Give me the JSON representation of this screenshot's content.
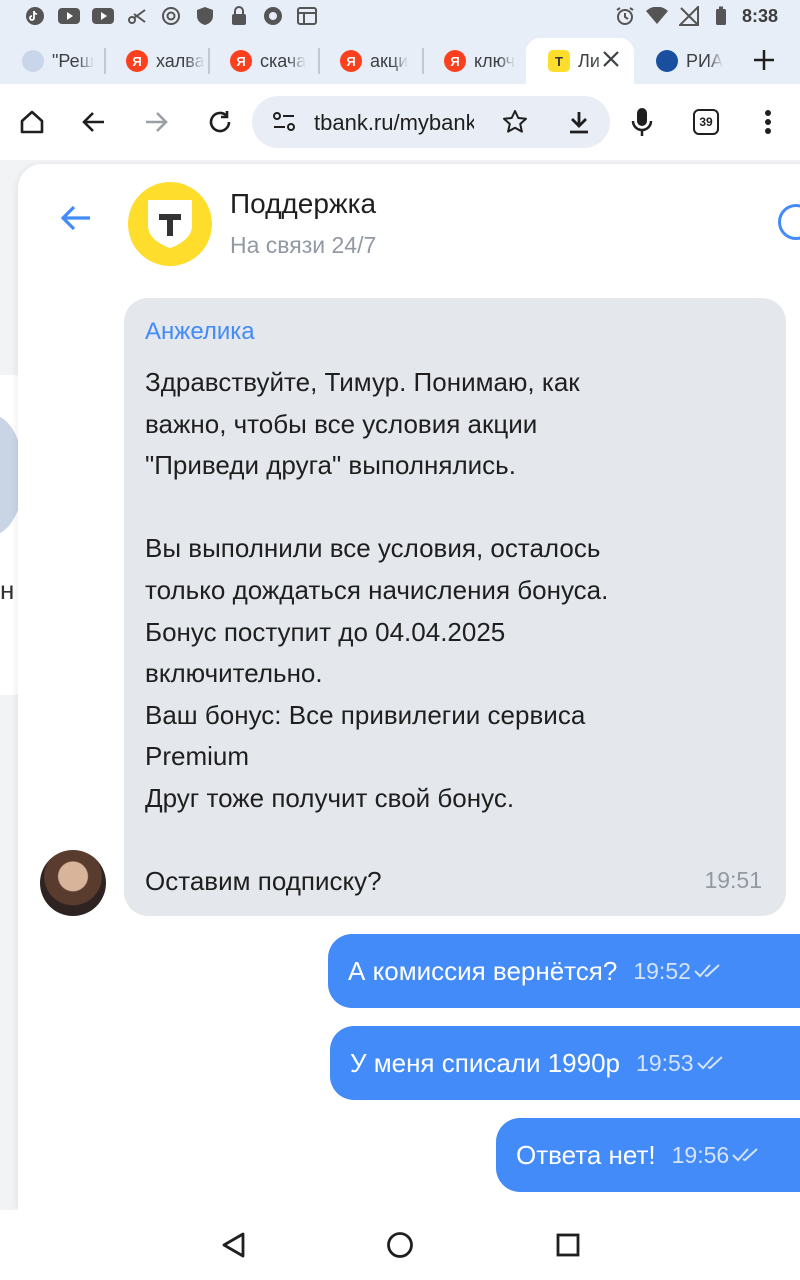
{
  "status_bar": {
    "time": "8:38",
    "left_icons": [
      "tiktok-icon",
      "youtube-icon",
      "youtube-icon",
      "scissors-icon",
      "at-icon",
      "shield-icon",
      "lock-icon",
      "chrome-icon",
      "calendar-icon"
    ],
    "right_icons": [
      "alarm-icon",
      "wifi-icon",
      "no-signal-icon",
      "battery-icon"
    ]
  },
  "tabs": [
    {
      "label": "\"Реш",
      "favicon": "resh-icon"
    },
    {
      "label": "халва",
      "favicon": "yandex-icon"
    },
    {
      "label": "скача",
      "favicon": "yandex-icon"
    },
    {
      "label": "акци",
      "favicon": "yandex-icon"
    },
    {
      "label": "ключ",
      "favicon": "yandex-icon"
    },
    {
      "label": "Ли",
      "favicon": "tbank-icon",
      "active": true
    },
    {
      "label": "РИА",
      "favicon": "ria-icon"
    }
  ],
  "toolbar": {
    "url": "tbank.ru/mybank",
    "tab_count": "39"
  },
  "chat": {
    "title": "Поддержка",
    "subtitle": "На связи 24/7",
    "incoming": {
      "sender": "Анжелика",
      "lines": [
        "Здравствуйте, Тимур. Понимаю, как",
        "важно, чтобы все условия акции",
        "\"Приведи друга\" выполнялись.",
        "",
        "Вы выполнили все условия, осталось",
        "только дождаться начисления бонуса.",
        "Бонус поступит до 04.04.2025",
        "включительно.",
        "Ваш бонус: Все привилегии сервиса",
        "Premium",
        "Друг тоже получит свой бонус.",
        "",
        "Оставим подписку?"
      ],
      "time": "19:51"
    },
    "outgoing": [
      {
        "text": "А комиссия вернётся?",
        "time": "19:52"
      },
      {
        "text": "У меня списали 1990р",
        "time": "19:53"
      },
      {
        "text": "Ответа нет!",
        "time": "19:56"
      }
    ]
  },
  "colors": {
    "accent_blue": "#428bf9",
    "brand_yellow": "#ffdd2d",
    "bubble_gray": "#e4e7ec",
    "chrome_bg": "#e8eef8"
  }
}
